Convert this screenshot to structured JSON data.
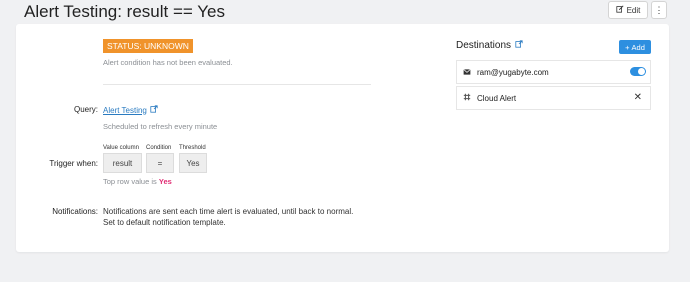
{
  "header": {
    "title": "Alert Testing: result == Yes",
    "edit_label": "Edit",
    "more_label": "⋮"
  },
  "status": {
    "badge": "STATUS: UNKNOWN",
    "note": "Alert condition has not been evaluated."
  },
  "query": {
    "label": "Query:",
    "link_text": "Alert Testing",
    "schedule": "Scheduled to refresh every minute"
  },
  "trigger": {
    "label": "Trigger when:",
    "columns": [
      {
        "label": "Value column",
        "value": "result"
      },
      {
        "label": "Condition",
        "value": "="
      },
      {
        "label": "Threshold",
        "value": "Yes"
      }
    ],
    "top_row_prefix": "Top row value is",
    "top_row_value": "Yes"
  },
  "notifications": {
    "label": "Notifications:",
    "line1": "Notifications are sent each time alert is evaluated, until back to normal.",
    "line2": "Set to default notification template."
  },
  "destinations": {
    "title": "Destinations",
    "add_label": "Add",
    "items": [
      {
        "label": "ram@yugabyte.com",
        "icon": "envelope-icon",
        "toggle_on": true
      },
      {
        "label": "Cloud Alert",
        "icon": "slack-icon"
      }
    ]
  },
  "colors": {
    "accent": "#2d8fe0",
    "status_unknown": "#f0932b",
    "threshold_value": "#e02d73"
  }
}
